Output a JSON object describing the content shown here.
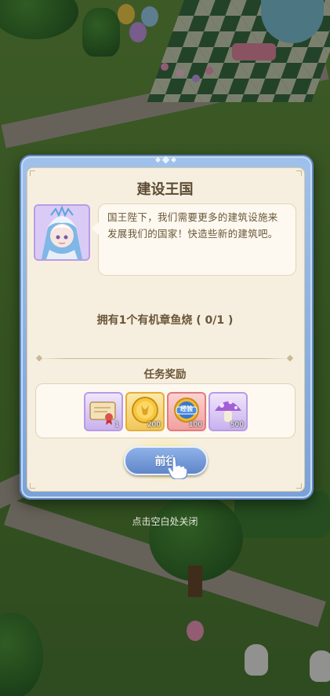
{
  "dialog": {
    "title": "建设王国",
    "message_line1": "国王陛下，我们需要更多的建筑设施来",
    "message_line2": "发展我们的国家！快造些新的建筑吧。",
    "task": "拥有1个有机章鱼烧 ( 0/1 )",
    "reward_title": "任务奖励",
    "rewards": [
      {
        "icon": "scroll-icon",
        "count": "1"
      },
      {
        "icon": "gold-coin-icon",
        "count": "200"
      },
      {
        "icon": "exp-badge-icon",
        "label": "经验",
        "count": "100"
      },
      {
        "icon": "mushroom-icon",
        "count": "500"
      }
    ],
    "go_button": "前往"
  },
  "close_hint": "点击空白处关闭",
  "colors": {
    "frame": "#7aa2d8",
    "panel": "#f6efdf",
    "text": "#6a5638",
    "button": "#6f94d4"
  }
}
